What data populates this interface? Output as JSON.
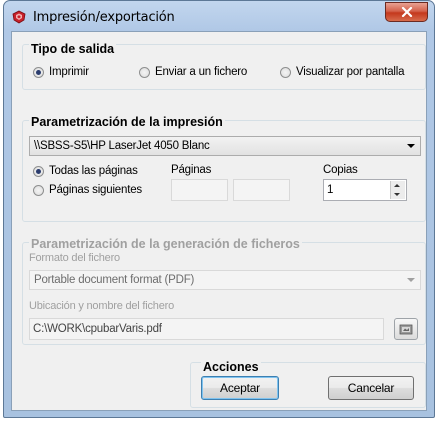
{
  "window": {
    "title": "Impresión/exportación"
  },
  "output_type": {
    "title": "Tipo de salida",
    "options": [
      {
        "label": "Imprimir",
        "checked": true
      },
      {
        "label": "Enviar a un fichero",
        "checked": false
      },
      {
        "label": "Visualizar por pantalla",
        "checked": false
      }
    ]
  },
  "print_settings": {
    "title": "Parametrización de la impresión",
    "printer": "\\\\SBSS-S5\\HP LaserJet 4050 Blanc",
    "pages_options": [
      {
        "label": "Todas las páginas",
        "checked": true
      },
      {
        "label": "Páginas siguientes",
        "checked": false
      }
    ],
    "pages_label": "Páginas",
    "from_page": "",
    "to_page": "",
    "copies_label": "Copias",
    "copies": "1"
  },
  "file_settings": {
    "title": "Parametrización de la generación de ficheros",
    "format_label": "Formato del fichero",
    "format": "Portable document format (PDF)",
    "location_label": "Ubicación y nombre del fichero",
    "location": "C:\\WORK\\cpubarVaris.pdf"
  },
  "actions": {
    "title": "Acciones",
    "accept": "Aceptar",
    "cancel": "Cancelar"
  }
}
